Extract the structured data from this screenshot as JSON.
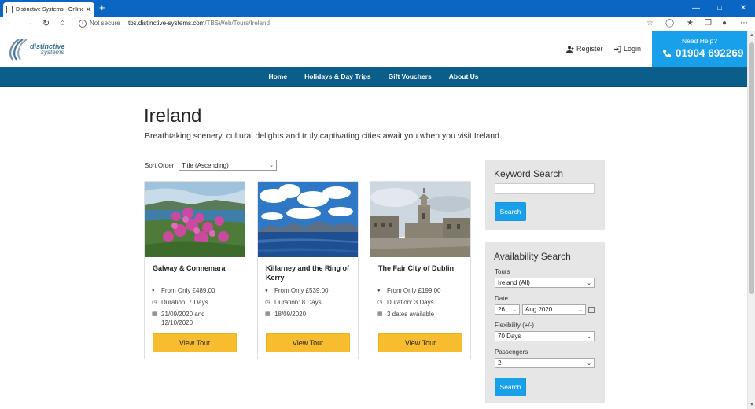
{
  "browser": {
    "tab_title": "Distinctive Systems - Online boo",
    "tab_close": "✕",
    "new_tab": "+",
    "security_label": "Not secure",
    "url_host": "tbs.distinctive-systems.com",
    "url_path": "/TBSWeb/Tours/Ireland",
    "icons": [
      "back-icon",
      "forward-icon",
      "refresh-icon",
      "home-icon",
      "favorite-icon",
      "shield-icon",
      "collections-icon",
      "reading-list-icon",
      "profile-icon",
      "menu-icon"
    ]
  },
  "header": {
    "logo_line1": "distinctive",
    "logo_line2": "systems",
    "register": "Register",
    "login": "Login",
    "help_label": "Need Help?",
    "phone": "01904 692269"
  },
  "nav": [
    "Home",
    "Holidays & Day Trips",
    "Gift Vouchers",
    "About Us"
  ],
  "page": {
    "title": "Ireland",
    "intro": "Breathtaking scenery, cultural delights and truly captivating cities await you when you visit Ireland.",
    "sort_label": "Sort Order",
    "sort_value": "Title (Ascending)"
  },
  "tours": [
    {
      "title": "Galway & Connemara",
      "price": "From Only £489.00",
      "duration": "Duration: 7 Days",
      "dates": "21/09/2020 and 12/10/2020",
      "button": "View Tour"
    },
    {
      "title": "Killarney and the Ring of Kerry",
      "price": "From Only £539.00",
      "duration": "Duration: 8 Days",
      "dates": "18/09/2020",
      "button": "View Tour"
    },
    {
      "title": "The Fair City of Dublin",
      "price": "From Only £199.00",
      "duration": "Duration: 3 Days",
      "dates": "3 dates available",
      "button": "View Tour"
    }
  ],
  "keyword_search": {
    "title": "Keyword Search",
    "button": "Search"
  },
  "availability": {
    "title": "Availability Search",
    "tours_label": "Tours",
    "tours_value": "Ireland (All)",
    "date_label": "Date",
    "day_value": "26",
    "month_value": "Aug 2020",
    "flex_label": "Flexibility (+/-)",
    "flex_value": "70 Days",
    "passengers_label": "Passengers",
    "passengers_value": "2",
    "button": "Search"
  },
  "colors": {
    "nav": "#0b5e89",
    "accent": "#19a0ea",
    "button_yellow": "#f7bd2f"
  }
}
